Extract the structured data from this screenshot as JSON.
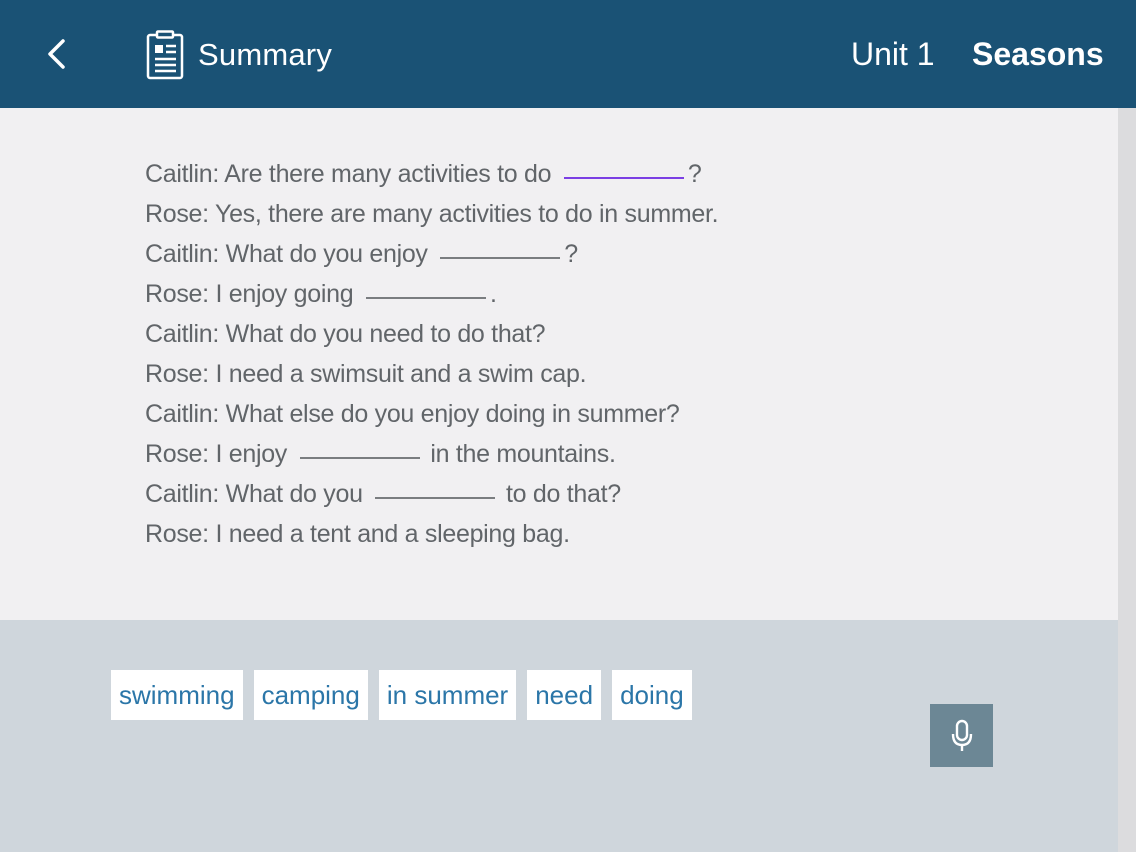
{
  "header": {
    "summary_label": "Summary",
    "unit_label": "Unit 1",
    "title": "Seasons"
  },
  "dialogue": [
    {
      "before": "Caitlin: Are there many activities to do ",
      "after": "?",
      "has_blank": true,
      "blank_active": true
    },
    {
      "before": "Rose: Yes, there are many activities to do in summer.",
      "after": "",
      "has_blank": false
    },
    {
      "before": "Caitlin: What do you enjoy ",
      "after": "?",
      "has_blank": true
    },
    {
      "before": "Rose: I enjoy going ",
      "after": ".",
      "has_blank": true
    },
    {
      "before": "Caitlin: What do you need to do that?",
      "after": "",
      "has_blank": false
    },
    {
      "before": "Rose: I need a swimsuit and a swim cap.",
      "after": "",
      "has_blank": false
    },
    {
      "before": "Caitlin: What else do you enjoy doing in summer?",
      "after": "",
      "has_blank": false
    },
    {
      "before": "Rose: I enjoy ",
      "after": " in the mountains.",
      "has_blank": true
    },
    {
      "before": "Caitlin: What do you ",
      "after": " to do that?",
      "has_blank": true
    },
    {
      "before": "Rose: I need a tent and a sleeping bag.",
      "after": "",
      "has_blank": false
    }
  ],
  "word_bank": [
    "swimming",
    "camping",
    "in summer",
    "need",
    "doing"
  ],
  "icons": {
    "back": "chevron-left-icon",
    "summary": "document-icon",
    "mic": "microphone-icon"
  },
  "colors": {
    "header_bg": "#1a5275",
    "chip_text": "#2b76a8",
    "active_blank": "#7b3fe4",
    "mic_bg": "#6c8795"
  }
}
